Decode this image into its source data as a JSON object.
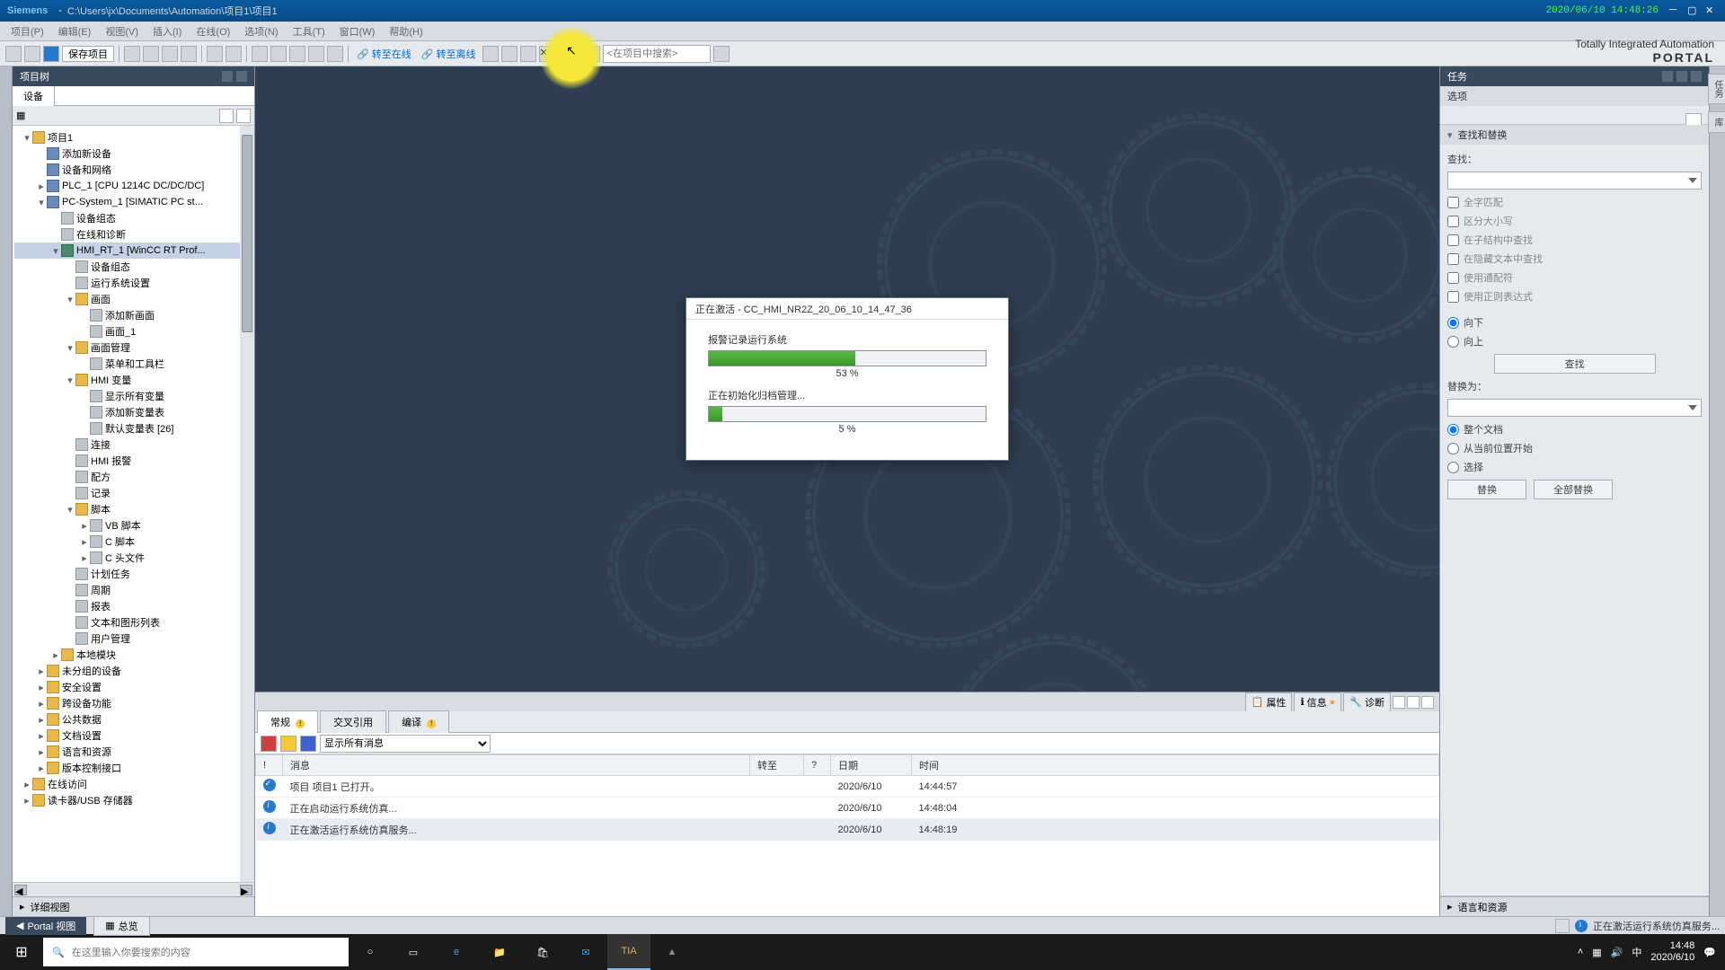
{
  "titlebar": {
    "brand": "Siemens",
    "sep": "-",
    "path": "C:\\Users\\jx\\Documents\\Automation\\项目1\\项目1",
    "timestamp": "2020/06/10 14:48:26"
  },
  "menubar": [
    "项目(P)",
    "编辑(E)",
    "视图(V)",
    "插入(I)",
    "在线(O)",
    "选项(N)",
    "工具(T)",
    "窗口(W)",
    "帮助(H)"
  ],
  "toolbar": {
    "save_label": "保存项目",
    "go_online": "转至在线",
    "go_offline": "转至离线",
    "search_placeholder": "<在项目中搜索>",
    "branding1": "Totally Integrated Automation",
    "branding2": "PORTAL"
  },
  "ptree": {
    "title": "项目树",
    "tab": "设备",
    "detail_label": "详细视图",
    "nodes": [
      {
        "d": 0,
        "exp": "▾",
        "icn": "folder",
        "label": "项目1"
      },
      {
        "d": 1,
        "exp": "",
        "icn": "dev",
        "label": "添加新设备"
      },
      {
        "d": 1,
        "exp": "",
        "icn": "dev",
        "label": "设备和网络"
      },
      {
        "d": 1,
        "exp": "▸",
        "icn": "dev",
        "label": "PLC_1 [CPU 1214C DC/DC/DC]"
      },
      {
        "d": 1,
        "exp": "▾",
        "icn": "dev",
        "label": "PC-System_1 [SIMATIC PC st..."
      },
      {
        "d": 2,
        "exp": "",
        "icn": "gen",
        "label": "设备组态"
      },
      {
        "d": 2,
        "exp": "",
        "icn": "gen",
        "label": "在线和诊断"
      },
      {
        "d": 2,
        "exp": "▾",
        "icn": "hmi",
        "label": "HMI_RT_1 [WinCC RT Prof...",
        "sel": true
      },
      {
        "d": 3,
        "exp": "",
        "icn": "gen",
        "label": "设备组态"
      },
      {
        "d": 3,
        "exp": "",
        "icn": "gen",
        "label": "运行系统设置"
      },
      {
        "d": 3,
        "exp": "▾",
        "icn": "folder",
        "label": "画面"
      },
      {
        "d": 4,
        "exp": "",
        "icn": "gen",
        "label": "添加新画面"
      },
      {
        "d": 4,
        "exp": "",
        "icn": "gen",
        "label": "画面_1"
      },
      {
        "d": 3,
        "exp": "▾",
        "icn": "folder",
        "label": "画面管理"
      },
      {
        "d": 4,
        "exp": "",
        "icn": "gen",
        "label": "菜单和工具栏"
      },
      {
        "d": 3,
        "exp": "▾",
        "icn": "folder",
        "label": "HMI 变量"
      },
      {
        "d": 4,
        "exp": "",
        "icn": "gen",
        "label": "显示所有变量"
      },
      {
        "d": 4,
        "exp": "",
        "icn": "gen",
        "label": "添加新变量表"
      },
      {
        "d": 4,
        "exp": "",
        "icn": "gen",
        "label": "默认变量表 [26]"
      },
      {
        "d": 3,
        "exp": "",
        "icn": "gen",
        "label": "连接"
      },
      {
        "d": 3,
        "exp": "",
        "icn": "gen",
        "label": "HMI 报警"
      },
      {
        "d": 3,
        "exp": "",
        "icn": "gen",
        "label": "配方"
      },
      {
        "d": 3,
        "exp": "",
        "icn": "gen",
        "label": "记录"
      },
      {
        "d": 3,
        "exp": "▾",
        "icn": "folder",
        "label": "脚本"
      },
      {
        "d": 4,
        "exp": "▸",
        "icn": "gen",
        "label": "VB 脚本"
      },
      {
        "d": 4,
        "exp": "▸",
        "icn": "gen",
        "label": "C 脚本"
      },
      {
        "d": 4,
        "exp": "▸",
        "icn": "gen",
        "label": "C 头文件"
      },
      {
        "d": 3,
        "exp": "",
        "icn": "gen",
        "label": "计划任务"
      },
      {
        "d": 3,
        "exp": "",
        "icn": "gen",
        "label": "周期"
      },
      {
        "d": 3,
        "exp": "",
        "icn": "gen",
        "label": "报表"
      },
      {
        "d": 3,
        "exp": "",
        "icn": "gen",
        "label": "文本和图形列表"
      },
      {
        "d": 3,
        "exp": "",
        "icn": "gen",
        "label": "用户管理"
      },
      {
        "d": 2,
        "exp": "▸",
        "icn": "folder",
        "label": "本地模块"
      },
      {
        "d": 1,
        "exp": "▸",
        "icn": "folder",
        "label": "未分组的设备"
      },
      {
        "d": 1,
        "exp": "▸",
        "icn": "folder",
        "label": "安全设置"
      },
      {
        "d": 1,
        "exp": "▸",
        "icn": "folder",
        "label": "跨设备功能"
      },
      {
        "d": 1,
        "exp": "▸",
        "icn": "folder",
        "label": "公共数据"
      },
      {
        "d": 1,
        "exp": "▸",
        "icn": "folder",
        "label": "文档设置"
      },
      {
        "d": 1,
        "exp": "▸",
        "icn": "folder",
        "label": "语言和资源"
      },
      {
        "d": 1,
        "exp": "▸",
        "icn": "folder",
        "label": "版本控制接口"
      },
      {
        "d": 0,
        "exp": "▸",
        "icn": "folder",
        "label": "在线访问"
      },
      {
        "d": 0,
        "exp": "▸",
        "icn": "folder",
        "label": "读卡器/USB 存储器"
      }
    ]
  },
  "dialog": {
    "title": "正在激活 - CC_HMI_NR2Z_20_06_10_14_47_36",
    "task1_label": "报警记录运行系统",
    "task1_pct_val": 53,
    "task1_pct": "53 %",
    "task2_label": "正在初始化归档管理...",
    "task2_pct_val": 5,
    "task2_pct": "5 %"
  },
  "infopanel": {
    "head_props": "属性",
    "head_info": "信息",
    "head_diag": "诊断",
    "tabs": {
      "general": "常规",
      "xref": "交叉引用",
      "compile": "编译"
    },
    "filter_label": "显示所有消息",
    "columns": {
      "icon": "!",
      "msg": "消息",
      "goto": "转至",
      "q": "?",
      "date": "日期",
      "time": "时间"
    },
    "rows": [
      {
        "type": "ok",
        "msg": "项目 项目1 已打开。",
        "date": "2020/6/10",
        "time": "14:44:57"
      },
      {
        "type": "info",
        "msg": "正在启动运行系统仿真...",
        "date": "2020/6/10",
        "time": "14:48:04"
      },
      {
        "type": "info",
        "msg": "正在激活运行系统仿真服务...",
        "date": "2020/6/10",
        "time": "14:48:19",
        "sel": true
      }
    ]
  },
  "rightpanel": {
    "title": "任务",
    "options": "选项",
    "find_replace": "查找和替换",
    "find_label": "查找：",
    "chk_whole": "全字匹配",
    "chk_case": "区分大小写",
    "chk_substruct": "在子结构中查找",
    "chk_hidden": "在隐藏文本中查找",
    "chk_wildcard": "使用通配符",
    "chk_regex": "使用正则表达式",
    "rad_down": "向下",
    "rad_up": "向上",
    "find_btn": "查找",
    "replace_label": "替换为：",
    "rad_whole_doc": "整个文档",
    "rad_from_pos": "从当前位置开始",
    "rad_selection": "选择",
    "replace_btn": "替换",
    "replace_all_btn": "全部替换",
    "lang_res": "语言和资源"
  },
  "rightrail": {
    "t1": "任务",
    "t2": "库"
  },
  "footer": {
    "portal_view": "Portal 视图",
    "overview": "总览",
    "status_msg": "正在激活运行系统仿真服务..."
  },
  "taskbar": {
    "search_placeholder": "在这里输入你要搜索的内容",
    "time": "14:48",
    "date": "2020/6/10"
  }
}
